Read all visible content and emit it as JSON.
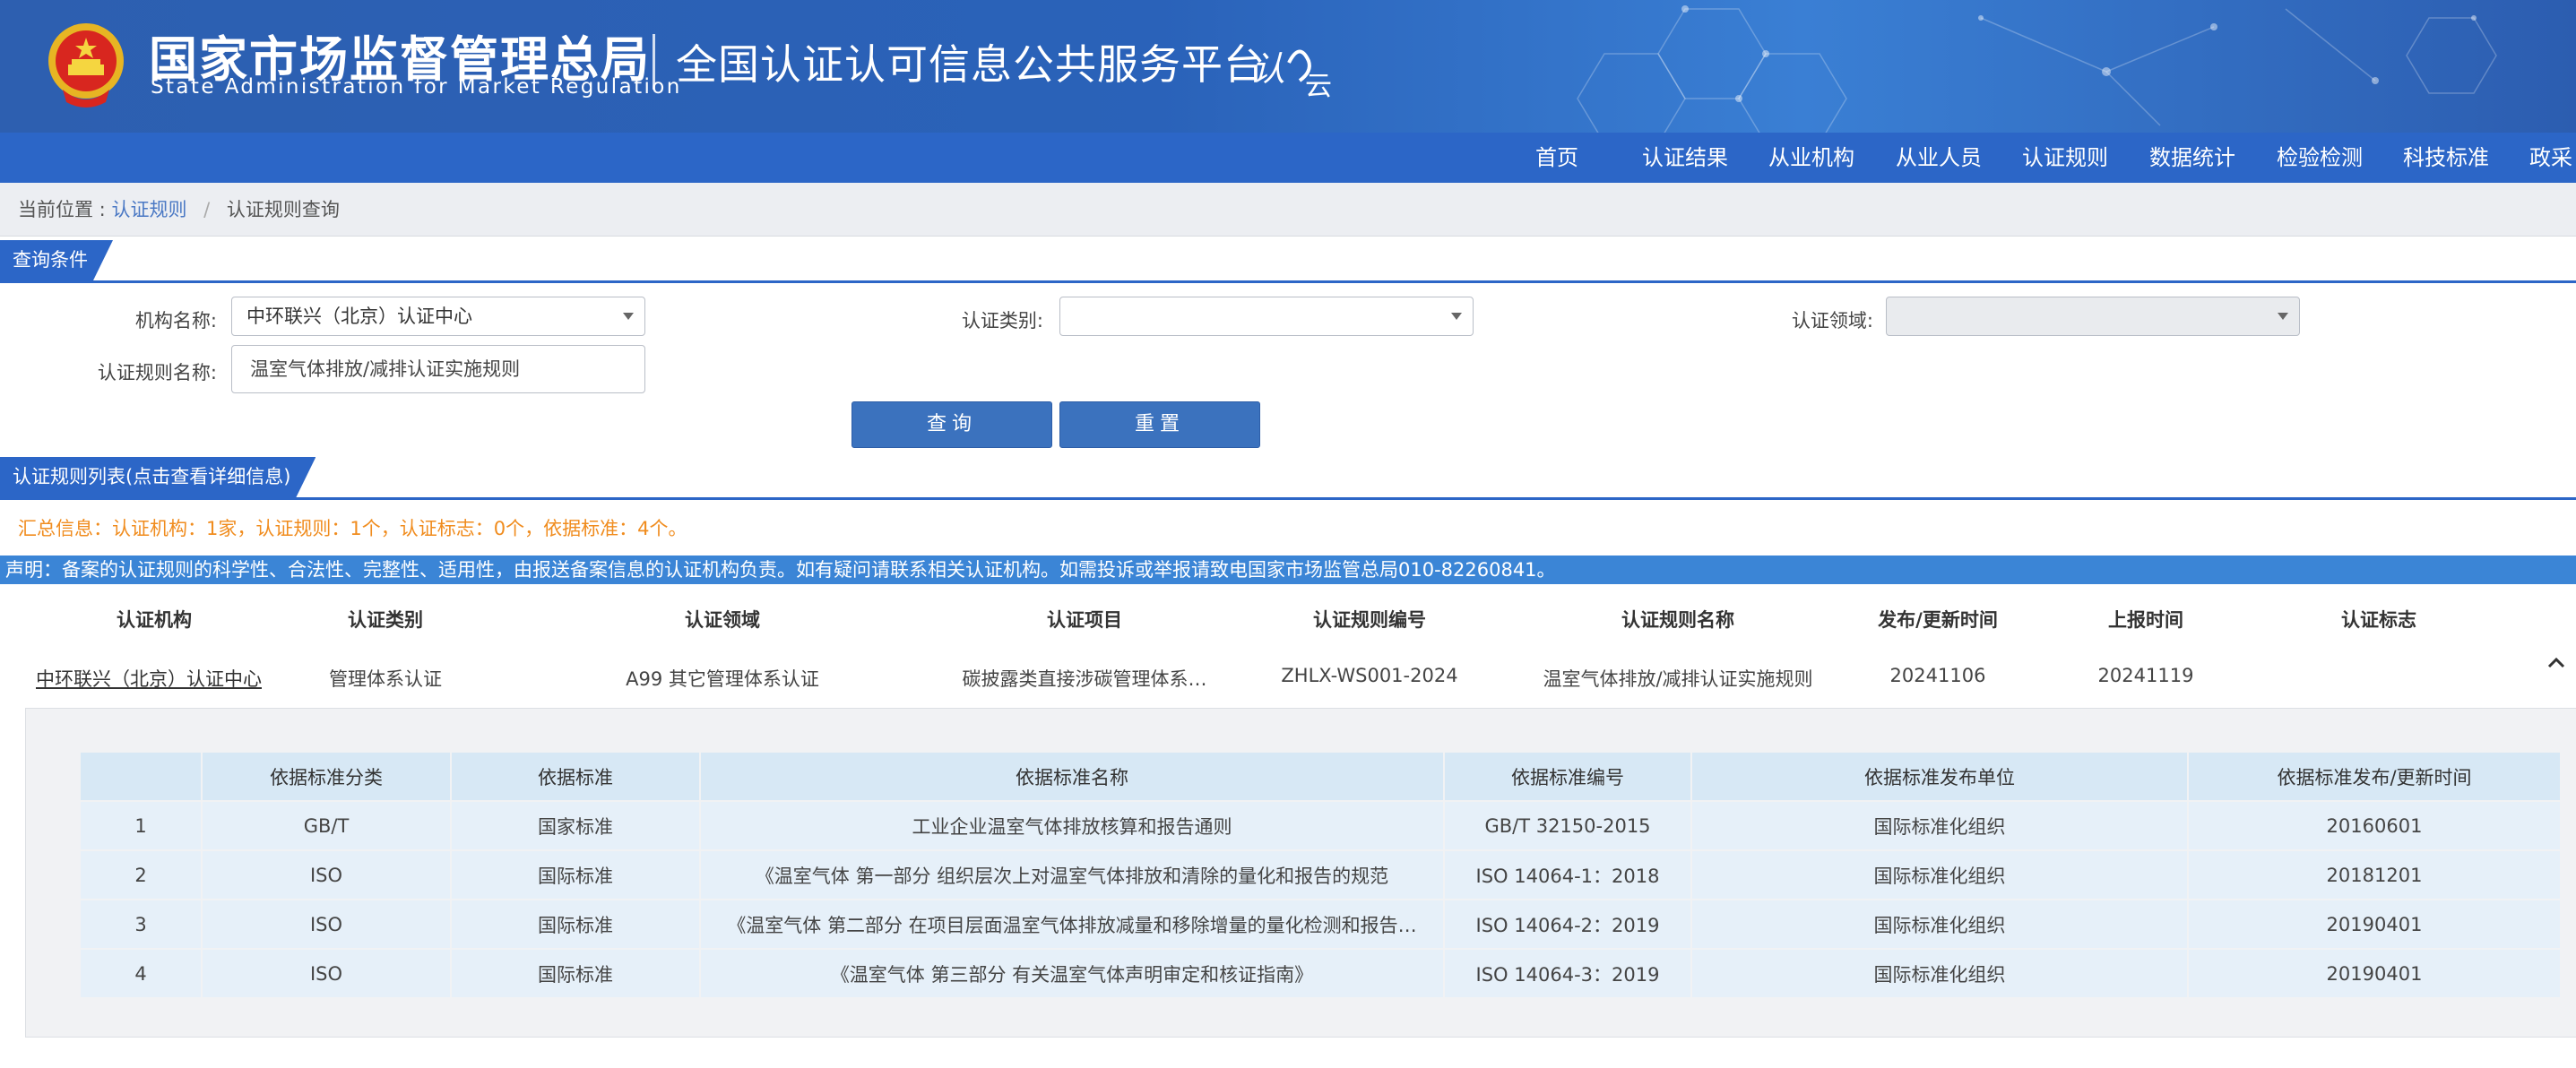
{
  "header": {
    "agency_cn": "国家市场监督管理总局",
    "agency_en": "State Administration  for  Market Regulation",
    "platform_name": "全国认证认可信息公共服务平台",
    "logo_text_a": "认",
    "logo_text_b": "云"
  },
  "nav": {
    "items": [
      "首页",
      "认证结果",
      "从业机构",
      "从业人员",
      "认证规则",
      "数据统计",
      "检验检测",
      "科技标准",
      "政采"
    ]
  },
  "breadcrumb": {
    "prefix": "当前位置 :",
    "link": "认证规则",
    "separator": "/",
    "current": "认证规则查询"
  },
  "query": {
    "section_title": "查询条件",
    "org_label": "机构名称:",
    "org_value": "中环联兴（北京）认证中心",
    "category_label": "认证类别:",
    "category_value": "",
    "field_label": "认证领域:",
    "field_value": "",
    "rule_name_label": "认证规则名称:",
    "rule_name_value": "温室气体排放/减排认证实施规则",
    "search_button": "查询",
    "reset_button": "重置"
  },
  "results": {
    "section_title": "认证规则列表(点击查看详细信息)",
    "summary": "汇总信息：认证机构：1家，认证规则：1个，认证标志：0个，依据标准：4个。",
    "notice": "声明：备案的认证规则的科学性、合法性、完整性、适用性，由报送备案信息的认证机构负责。如有疑问请联系相关认证机构。如需投诉或举报请致电国家市场监管总局010-82260841。",
    "columns": [
      "认证机构",
      "认证类别",
      "认证领域",
      "认证项目",
      "认证规则编号",
      "认证规则名称",
      "发布/更新时间",
      "上报时间",
      "认证标志"
    ],
    "row": {
      "org": "中环联兴（北京）认证中心",
      "category": "管理体系认证",
      "field": "A99 其它管理体系认证",
      "project": "碳披露类直接涉碳管理体系…",
      "rule_no": "ZHLX-WS001-2024",
      "rule_name": "温室气体排放/减排认证实施规则",
      "publish_date": "20241106",
      "report_date": "20241119",
      "mark": ""
    }
  },
  "standards": {
    "columns": [
      "",
      "依据标准分类",
      "依据标准",
      "依据标准名称",
      "依据标准编号",
      "依据标准发布单位",
      "依据标准发布/更新时间"
    ],
    "rows": [
      {
        "no": "1",
        "class": "GB/T",
        "type": "国家标准",
        "name": "工业企业温室气体排放核算和报告通则",
        "code": "GB/T 32150-2015",
        "issuer": "国际标准化组织",
        "date": "20160601"
      },
      {
        "no": "2",
        "class": "ISO",
        "type": "国际标准",
        "name": "《温室气体 第一部分 组织层次上对温室气体排放和清除的量化和报告的规范",
        "code": "ISO 14064-1：2018",
        "issuer": "国际标准化组织",
        "date": "20181201"
      },
      {
        "no": "3",
        "class": "ISO",
        "type": "国际标准",
        "name": "《温室气体 第二部分 在项目层面温室气体排放减量和移除增量的量化检测和报告…",
        "code": "ISO 14064-2：2019",
        "issuer": "国际标准化组织",
        "date": "20190401"
      },
      {
        "no": "4",
        "class": "ISO",
        "type": "国际标准",
        "name": "《温室气体 第三部分 有关温室气体声明审定和核证指南》",
        "code": "ISO 14064-3：2019",
        "issuer": "国际标准化组织",
        "date": "20190401"
      }
    ]
  },
  "colors": {
    "header_blue": "#2d5fb0",
    "nav_blue": "#2c66c7",
    "notice_blue": "#3b85d6",
    "summary_orange": "#f08c1e",
    "button_blue": "#3b72be"
  }
}
